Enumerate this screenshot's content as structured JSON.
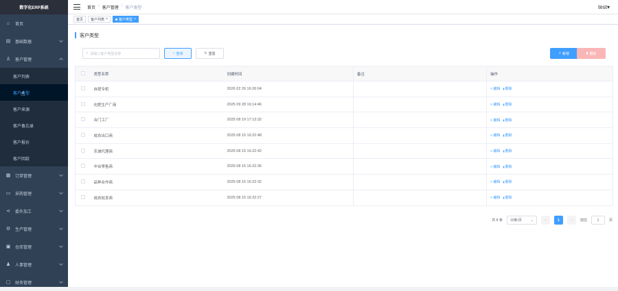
{
  "app": {
    "title": "数字化ERP系统",
    "user": "test"
  },
  "sidebar": {
    "items": [
      {
        "label": "首页",
        "icon": "home-icon",
        "glyph": "⌂",
        "has_children": false
      },
      {
        "label": "基础数据",
        "icon": "database-icon",
        "glyph": "▤",
        "has_children": true
      },
      {
        "label": "客户管理",
        "icon": "user-icon",
        "glyph": "♙",
        "has_children": true,
        "open": true
      },
      {
        "label": "订单管理",
        "icon": "order-icon",
        "glyph": "▦",
        "has_children": true
      },
      {
        "label": "采购管理",
        "icon": "cart-icon",
        "glyph": "▭",
        "has_children": true
      },
      {
        "label": "委外加工",
        "icon": "share-icon",
        "glyph": "⋖",
        "has_children": true
      },
      {
        "label": "生产管理",
        "icon": "production-icon",
        "glyph": "⚙",
        "has_children": true
      },
      {
        "label": "仓库管理",
        "icon": "warehouse-icon",
        "glyph": "▣",
        "has_children": true
      },
      {
        "label": "人事管理",
        "icon": "person-icon",
        "glyph": "♟",
        "has_children": true
      },
      {
        "label": "财务管理",
        "icon": "finance-icon",
        "glyph": "▢",
        "has_children": true
      }
    ],
    "customer_submenu": [
      "客户列表",
      "客户类型",
      "客户来源",
      "客户备忘录",
      "客户报价",
      "客户回款"
    ],
    "active_sub": "客户类型"
  },
  "breadcrumb": [
    "首页",
    "客户管理",
    "客户类型"
  ],
  "tags": [
    {
      "label": "首页",
      "active": false,
      "closable": false
    },
    {
      "label": "客户列表",
      "active": false,
      "closable": true
    },
    {
      "label": "客户类型",
      "active": true,
      "closable": true
    }
  ],
  "page": {
    "title": "客户类型",
    "search_placeholder": "请输入客户类型名称",
    "query_label": "查询",
    "reset_label": "重置",
    "add_label": "新增",
    "delete_label": "删除"
  },
  "table": {
    "headers": [
      "类型名称",
      "创建时间",
      "备注",
      "操作"
    ],
    "rows": [
      {
        "name": "自提专柜",
        "created": "2026 02 26 16:26:04",
        "note": ""
      },
      {
        "name": "化肥生产厂商",
        "created": "2025 09 28 16:14:46",
        "note": ""
      },
      {
        "name": "合门工厂",
        "created": "2025 08 19 17:13:32",
        "note": ""
      },
      {
        "name": "成衣出口商",
        "created": "2025 08 15 16:22:48",
        "note": ""
      },
      {
        "name": "灰城代理商",
        "created": "2025 08 15 16:22:42",
        "note": ""
      },
      {
        "name": "中台零售商",
        "created": "2025 08 15 16:22:36",
        "note": ""
      },
      {
        "name": "品种合作商",
        "created": "2025 08 15 16:22:32",
        "note": ""
      },
      {
        "name": "成衣批发商",
        "created": "2025 08 15 16:22:27",
        "note": ""
      }
    ],
    "op_edit": "编辑",
    "op_delete": "删除"
  },
  "pagination": {
    "total_text": "共 8 条",
    "page_size": "10条/页",
    "current_page": "1",
    "goto_label": "前往",
    "goto_value": "1",
    "page_unit": "页"
  },
  "colors": {
    "accent": "#409eff",
    "sidebar_bg": "#304156",
    "danger_light": "#fab6b6"
  }
}
